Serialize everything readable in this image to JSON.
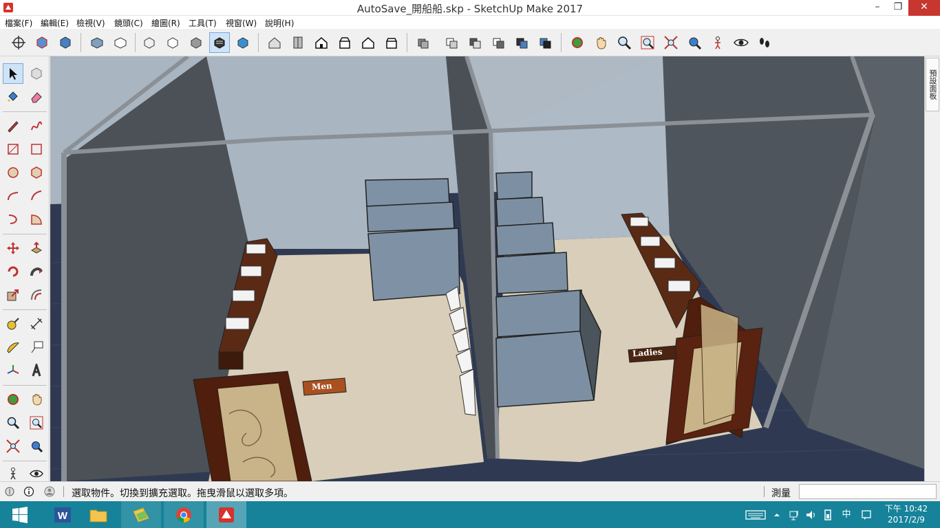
{
  "window": {
    "title": "AutoSave_開船船.skp - SketchUp Make 2017",
    "minimize": "–",
    "maximize": "❐",
    "close": "✕"
  },
  "menu": {
    "items": [
      "檔案(F)",
      "編輯(E)",
      "檢視(V)",
      "鏡頭(C)",
      "繪圖(R)",
      "工具(T)",
      "視窗(W)",
      "說明(H)"
    ]
  },
  "tray_panel": {
    "label": "預設面板"
  },
  "scene": {
    "sign_men": "Men",
    "sign_ladies": "Ladies"
  },
  "status": {
    "message": "選取物件。切換到擴充選取。拖曳滑鼠以選取多項。",
    "measure_label": "測量",
    "measure_value": ""
  },
  "taskbar": {
    "apps": [
      "start",
      "word",
      "file-explorer",
      "photos",
      "chrome",
      "sketchup"
    ],
    "ime": "中",
    "clock_ampm_time": "下午 10:42",
    "clock_date": "2017/2/9"
  },
  "colors": {
    "sky": "#a8b4bf",
    "wall_dark": "#4d5258",
    "floor": "#d8cdb9",
    "carpet": "#2f3a52",
    "partition": "#7b8da2",
    "wood": "#6b2f16",
    "sign": "#a9501f",
    "accent_red": "#c7372f"
  }
}
